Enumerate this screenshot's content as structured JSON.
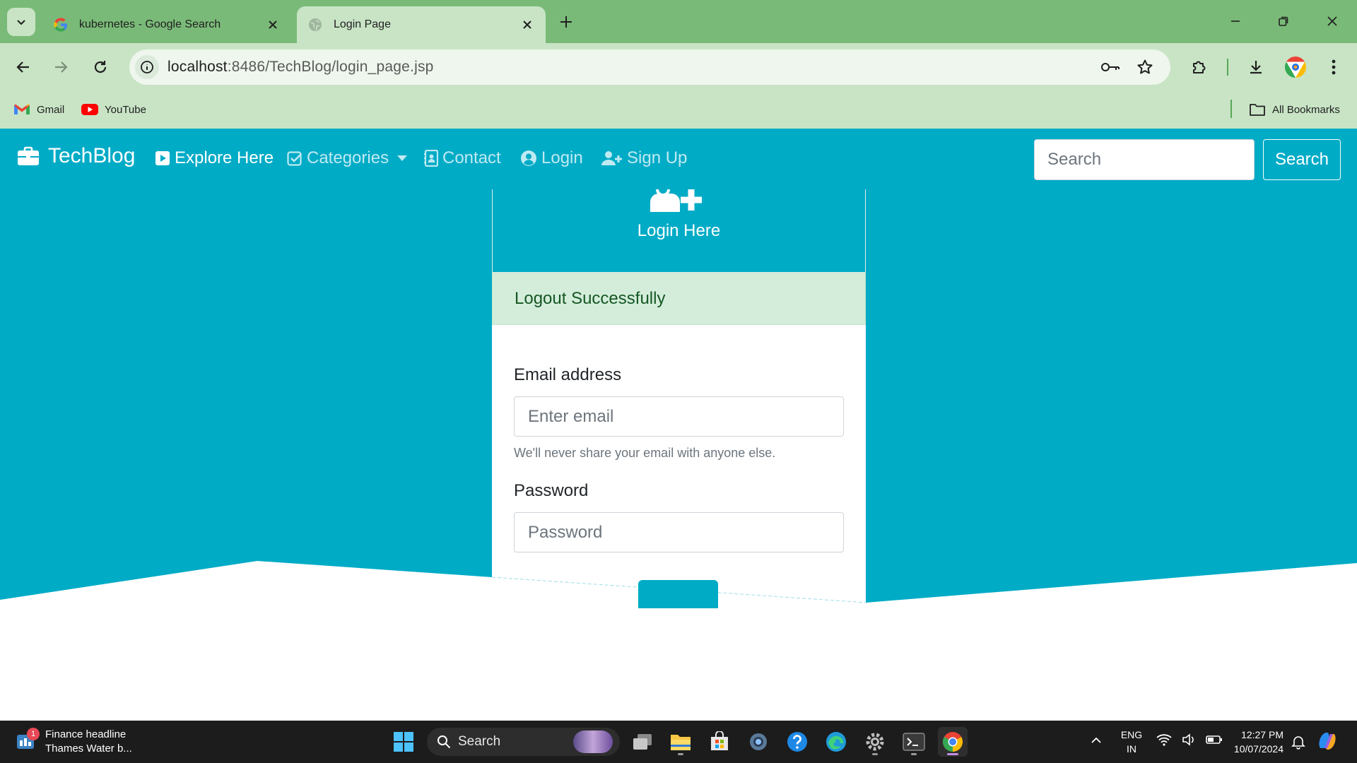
{
  "browser": {
    "tabs": [
      {
        "title": "kubernetes - Google Search",
        "favicon": "google-g-icon",
        "active": false
      },
      {
        "title": "Login Page",
        "favicon": "globe-icon",
        "active": true
      }
    ],
    "url_host": "localhost",
    "url_rest": ":8486/TechBlog/login_page.jsp",
    "bookmarks": [
      {
        "label": "Gmail",
        "icon": "gmail-icon"
      },
      {
        "label": "YouTube",
        "icon": "youtube-icon"
      }
    ],
    "all_bookmarks_label": "All Bookmarks",
    "colors": {
      "frame": "#7aba78",
      "toolbar": "#c8e4c5"
    }
  },
  "site": {
    "brand": "TechBlog",
    "nav": [
      {
        "label": "Explore Here",
        "icon": "play-square-icon"
      },
      {
        "label": "Categories",
        "icon": "check-square-icon"
      },
      {
        "label": "Contact",
        "icon": "address-book-icon"
      },
      {
        "label": "Login",
        "icon": "user-circle-icon"
      },
      {
        "label": "Sign Up",
        "icon": "user-plus-icon"
      }
    ],
    "search_placeholder": "Search",
    "search_button": "Search",
    "colors": {
      "primary": "#00abc6",
      "alert_bg": "#d4edda",
      "alert_text": "#155724"
    }
  },
  "login_card": {
    "title": "Login Here",
    "alert": "Logout Successfully",
    "email_label": "Email address",
    "email_placeholder": "Enter email",
    "email_help": "We'll never share your email with anyone else.",
    "password_label": "Password",
    "password_placeholder": "Password"
  },
  "taskbar": {
    "news_badge": "1",
    "news_title": "Finance headline",
    "news_subtitle": "Thames Water b...",
    "search_label": "Search",
    "lang_top": "ENG",
    "lang_bottom": "IN",
    "time": "12:27 PM",
    "date": "10/07/2024"
  }
}
